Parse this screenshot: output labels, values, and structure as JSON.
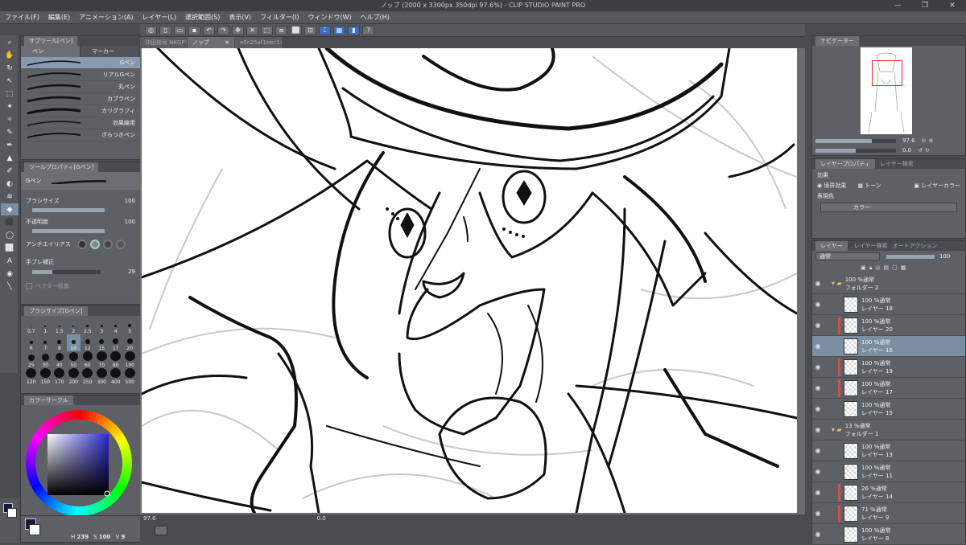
{
  "window": {
    "title": "ノッブ (2000 x 3300px 350dpi 97.6%)  - CLIP STUDIO PAINT PRO",
    "minimize": "—",
    "maximize": "❐",
    "close": "✕"
  },
  "menu": [
    "ファイル(F)",
    "編集(E)",
    "アニメーション(A)",
    "レイヤー(L)",
    "選択範囲(S)",
    "表示(V)",
    "フィルター(I)",
    "ウィンドウ(W)",
    "ヘルプ(H)"
  ],
  "subtool": {
    "panel_title": "サブツール[ペン]",
    "tabs": [
      "ペン",
      "マーカー"
    ],
    "brushes": [
      "Gペン",
      "リアルGペン",
      "丸ペン",
      "カブラペン",
      "カリグラフィ",
      "効果線用",
      "ざらつきペン"
    ]
  },
  "toolprop": {
    "panel_title": "ツールプロパティ[Gペン]",
    "brush_name": "Gペン",
    "size_label": "ブラシサイズ",
    "size_value": "100",
    "opacity_label": "不透明度",
    "opacity_value": "100",
    "aa_label": "アンチエイリアス",
    "stab_label": "手ブレ補正",
    "stab_value": "29",
    "vector_label": "ベクター吸着"
  },
  "brushsize": {
    "panel_title": "ブラシサイズ[Gペン]",
    "sizes": [
      "0.7",
      "1",
      "1.5",
      "2",
      "2.5",
      "3",
      "4",
      "5",
      "6",
      "7",
      "8",
      "10",
      "12",
      "15",
      "17",
      "20",
      "25",
      "30",
      "40",
      "50",
      "60",
      "70",
      "80",
      "100",
      "120",
      "150",
      "170",
      "200",
      "250",
      "300",
      "400",
      "500"
    ]
  },
  "color": {
    "panel_title": "カラーサークル",
    "h": "239",
    "s": "100",
    "v": "9",
    "main": "#1a1a66"
  },
  "docs": [
    {
      "name": "沖田総司 NKGP",
      "active": false
    },
    {
      "name": "ノッブ",
      "active": true
    },
    {
      "name": "e5c25af1eec1",
      "active": false
    }
  ],
  "status": {
    "zoom": "97.6",
    "angle": "0.0"
  },
  "navigator": {
    "panel_title": "ナビゲーター",
    "zoom": "97.6",
    "angle": "0.0"
  },
  "layerprop": {
    "panel_title": "レイヤープロパティ",
    "tab2": "レイヤー検索",
    "effect_label": "効果",
    "border_effect": "境界効果",
    "tone": "トーン",
    "layer_color": "レイヤーカラー",
    "expr_label": "表現色",
    "expr_value": "カラー"
  },
  "layers": {
    "tabs": [
      "レイヤー",
      "レイヤー検索",
      "オートアクション"
    ],
    "blend": "通常",
    "opacity": "100",
    "items": [
      {
        "line1": "100 %通常",
        "line2": "フォルダー 2",
        "folder": true,
        "color": "",
        "selected": false
      },
      {
        "line1": "100 %通常",
        "line2": "レイヤー 18",
        "folder": false,
        "color": "",
        "selected": false
      },
      {
        "line1": "100 %通常",
        "line2": "レイヤー 20",
        "folder": false,
        "color": "#d05050",
        "selected": false
      },
      {
        "line1": "100 %通常",
        "line2": "レイヤー 16",
        "folder": false,
        "color": "",
        "selected": true
      },
      {
        "line1": "100 %通常",
        "line2": "レイヤー 19",
        "folder": false,
        "color": "#d05050",
        "selected": false
      },
      {
        "line1": "100 %通常",
        "line2": "レイヤー 17",
        "folder": false,
        "color": "#d05050",
        "selected": false
      },
      {
        "line1": "100 %通常",
        "line2": "レイヤー 15",
        "folder": false,
        "color": "",
        "selected": false
      },
      {
        "line1": "13 %通常",
        "line2": "フォルダー 1",
        "folder": true,
        "color": "",
        "selected": false
      },
      {
        "line1": "100 %通常",
        "line2": "レイヤー 13",
        "folder": false,
        "color": "",
        "selected": false
      },
      {
        "line1": "100 %通常",
        "line2": "レイヤー 11",
        "folder": false,
        "color": "",
        "selected": false
      },
      {
        "line1": "26 %通常",
        "line2": "レイヤー 14",
        "folder": false,
        "color": "#d05050",
        "selected": false
      },
      {
        "line1": "71 %通常",
        "line2": "レイヤー 9",
        "folder": false,
        "color": "#d05050",
        "selected": false
      },
      {
        "line1": "100 %通常",
        "line2": "レイヤー 8",
        "folder": false,
        "color": "",
        "selected": false
      }
    ]
  },
  "tools": [
    "⌕",
    "✋",
    "↻",
    "↖",
    "⬚",
    "✦",
    "✧",
    "✎",
    "✒",
    "▲",
    "✐",
    "◐",
    "≋",
    "◆",
    "⬛",
    "◯",
    "⬜",
    "A",
    "◉",
    "╲"
  ]
}
